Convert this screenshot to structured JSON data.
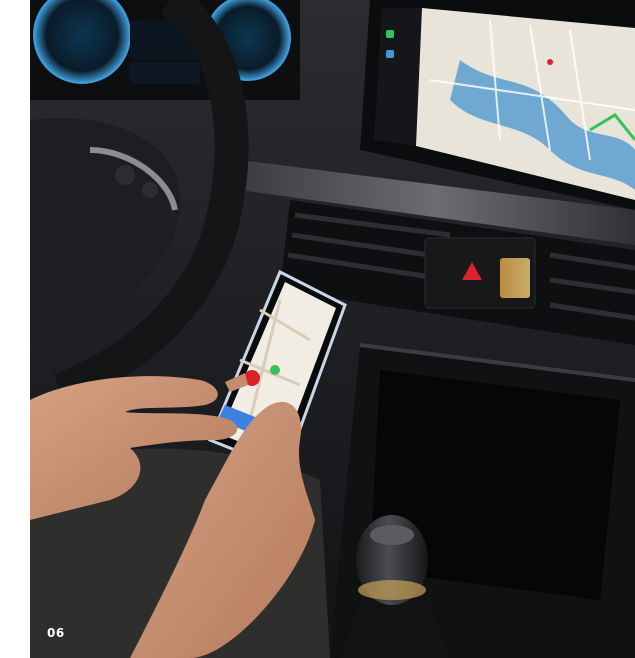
{
  "photo": {
    "subject": "photo-car-interior-smartphone-navigation"
  },
  "page_number": "06",
  "colors": {
    "page_background": "#ffffff",
    "dashboard": "#1b1d20",
    "cluster_accent": "#3f9ad8",
    "map_land": "#e9e4da",
    "map_water": "#6fa9d1",
    "hazard_red": "#d9222a",
    "page_number_text": "#ffffff"
  }
}
